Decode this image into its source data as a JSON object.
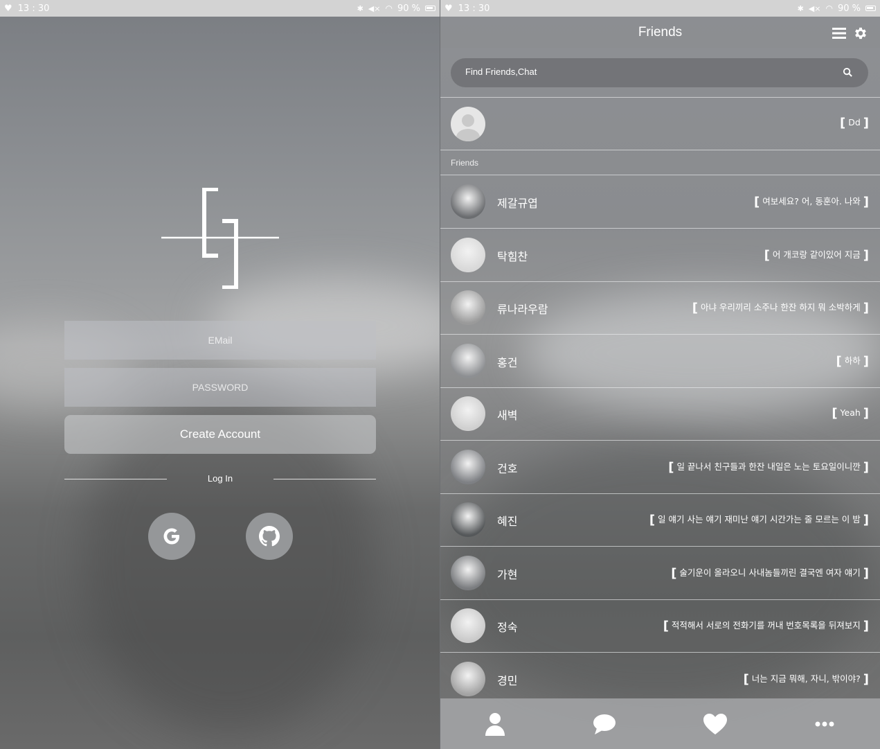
{
  "status_bar": {
    "time": "13 : 30",
    "battery": "90 %"
  },
  "login": {
    "email_placeholder": "EMail",
    "password_placeholder": "PASSWORD",
    "create_account_label": "Create Account",
    "login_label": "Log In"
  },
  "friends": {
    "title": "Friends",
    "search_placeholder": "Find Friends,Chat",
    "section_label": "Friends",
    "me": {
      "status": "Dd"
    },
    "list": [
      {
        "name": "제갈규엽",
        "status": "여보세요? 어, 동훈아. 나와"
      },
      {
        "name": "탁힘찬",
        "status": "어 개코랑 같이있어 지금"
      },
      {
        "name": "류나라우람",
        "status": "아냐 우리끼리 소주나 한잔 하지 뭐 소박하게"
      },
      {
        "name": "홍건",
        "status": "하하"
      },
      {
        "name": "새벽",
        "status": "Yeah"
      },
      {
        "name": "건호",
        "status": "일 끝나서 친구들과 한잔 내일은 노는 토요일이니깐"
      },
      {
        "name": "혜진",
        "status": "일 얘기 사는 얘기 재미난 얘기 시간가는 줄 모르는 이 밤"
      },
      {
        "name": "가현",
        "status": "술기운이 올라오니 사내놈들끼린 결국엔 여자 얘기"
      },
      {
        "name": "정숙",
        "status": "적적해서 서로의 전화기를 꺼내 번호목록을 뒤져보지"
      },
      {
        "name": "경민",
        "status": "너는 지금 뭐해, 자니, 밖이야?"
      }
    ]
  }
}
